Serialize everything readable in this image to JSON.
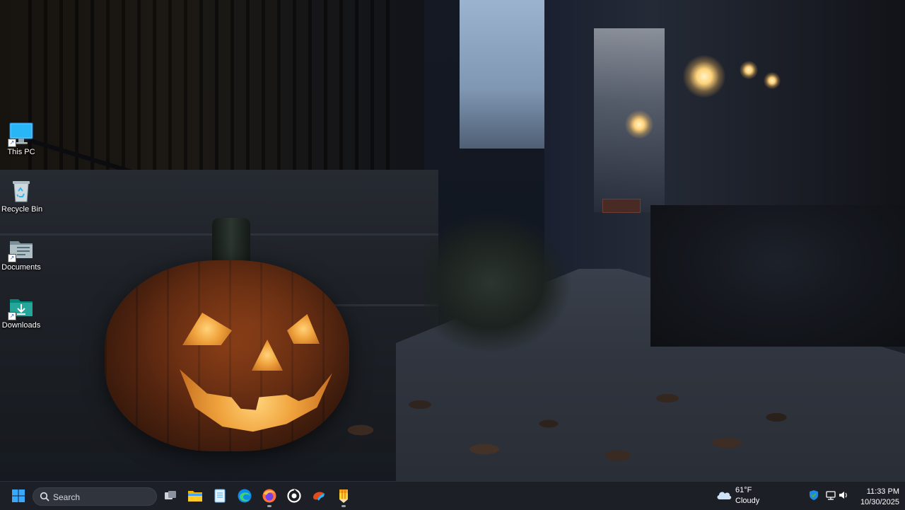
{
  "desktop": {
    "icons": [
      {
        "label": "This PC",
        "icon": "monitor-icon"
      },
      {
        "label": "Recycle Bin",
        "icon": "recycle-bin-icon"
      },
      {
        "label": "Documents",
        "icon": "documents-folder-icon"
      },
      {
        "label": "Downloads",
        "icon": "downloads-folder-icon"
      }
    ]
  },
  "taskbar": {
    "search_placeholder": "Search",
    "apps": [
      {
        "name": "Start",
        "icon": "windows-start-icon"
      },
      {
        "name": "Task View",
        "icon": "task-view-icon"
      },
      {
        "name": "File Explorer",
        "icon": "file-explorer-icon"
      },
      {
        "name": "Notepad",
        "icon": "notepad-icon"
      },
      {
        "name": "Microsoft Edge",
        "icon": "edge-browser-icon"
      },
      {
        "name": "Firefox",
        "icon": "firefox-icon"
      },
      {
        "name": "Media Player",
        "icon": "media-player-icon"
      },
      {
        "name": "Paint / Snipping",
        "icon": "brush-app-icon"
      },
      {
        "name": "Pencil Tool",
        "icon": "pencil-app-icon"
      }
    ],
    "weather": {
      "temperature": "61°F",
      "condition": "Cloudy",
      "icon": "cloud-icon"
    },
    "tray": [
      {
        "icon": "windows-security-icon"
      },
      {
        "icon": "network-icon"
      },
      {
        "icon": "volume-icon"
      }
    ],
    "clock": {
      "time": "11:33 PM",
      "date": "10/30/2025"
    }
  },
  "colors": {
    "taskbar_bg": "#1c1f26",
    "accent": "#0a84ff",
    "icon_label": "#ffffff"
  }
}
